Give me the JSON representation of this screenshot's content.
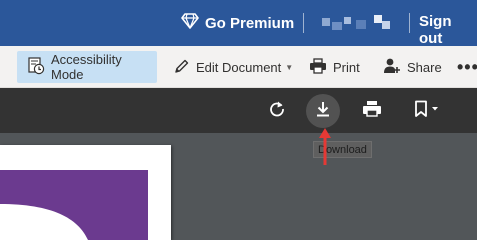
{
  "topbar": {
    "premium_label": "Go Premium",
    "signout_label": "Sign out",
    "background": "#2b579a"
  },
  "ribbon": {
    "accessibility_label": "Accessibility Mode",
    "edit_label": "Edit Document",
    "print_label": "Print",
    "share_label": "Share",
    "more_label": "•••"
  },
  "viewer_toolbar": {
    "tooltip": "Download"
  },
  "colors": {
    "accent": "#2b579a",
    "selected": "#c7e0f4",
    "viewer_toolbar": "#333333",
    "doc_background": "#525659",
    "page_purple": "#6b3a8f",
    "annotation_arrow": "#e53935"
  },
  "icons": [
    "diamond-icon",
    "accessibility-icon",
    "pencil-icon",
    "printer-icon",
    "add-person-icon",
    "rotate-icon",
    "download-icon",
    "printer-icon",
    "bookmark-icon",
    "caret-down-icon"
  ]
}
